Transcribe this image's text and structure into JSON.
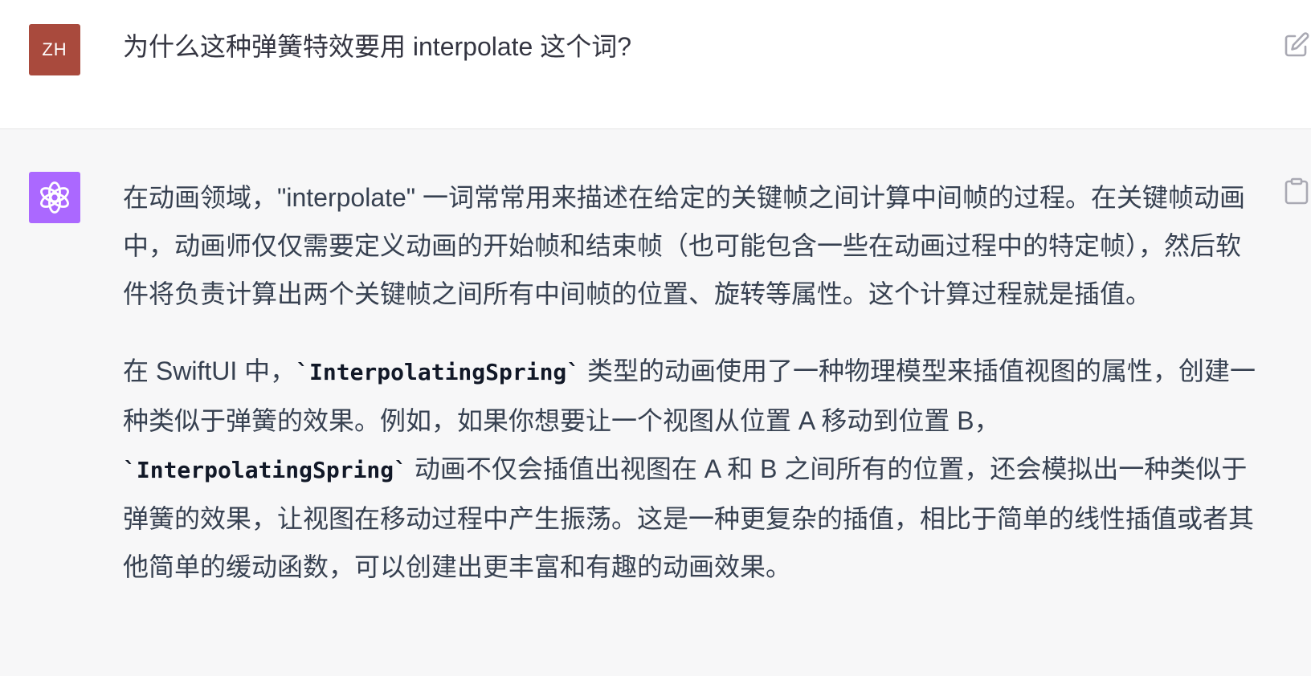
{
  "user": {
    "avatar_initials": "ZH",
    "message": "为什么这种弹簧特效要用 interpolate 这个词?"
  },
  "assistant": {
    "paragraph1": "在动画领域，\"interpolate\" 一词常常用来描述在给定的关键帧之间计算中间帧的过程。在关键帧动画中，动画师仅仅需要定义动画的开始帧和结束帧（也可能包含一些在动画过程中的特定帧），然后软件将负责计算出两个关键帧之间所有中间帧的位置、旋转等属性。这个计算过程就是插值。",
    "paragraph2": {
      "part1": "在 SwiftUI 中，",
      "code1": "`InterpolatingSpring`",
      "part2": " 类型的动画使用了一种物理模型来插值视图的属性，创建一种类似于弹簧的效果。例如，如果你想要让一个视图从位置 A 移动到位置 B，",
      "code2": "`InterpolatingSpring`",
      "part3": " 动画不仅会插值出视图在 A 和 B 之间所有的位置，还会模拟出一种类似于弹簧的效果，让视图在移动过程中产生振荡。这是一种更复杂的插值，相比于简单的线性插值或者其他简单的缓动函数，可以创建出更丰富和有趣的动画效果。"
    }
  },
  "icons": {
    "edit": "edit-icon",
    "copy": "clipboard-icon",
    "assistant_logo": "openai-logo-icon"
  },
  "colors": {
    "user_avatar": "#a94a3d",
    "assistant_avatar": "#ab68ff",
    "assistant_bg": "#f7f7f8",
    "text": "#374151"
  }
}
